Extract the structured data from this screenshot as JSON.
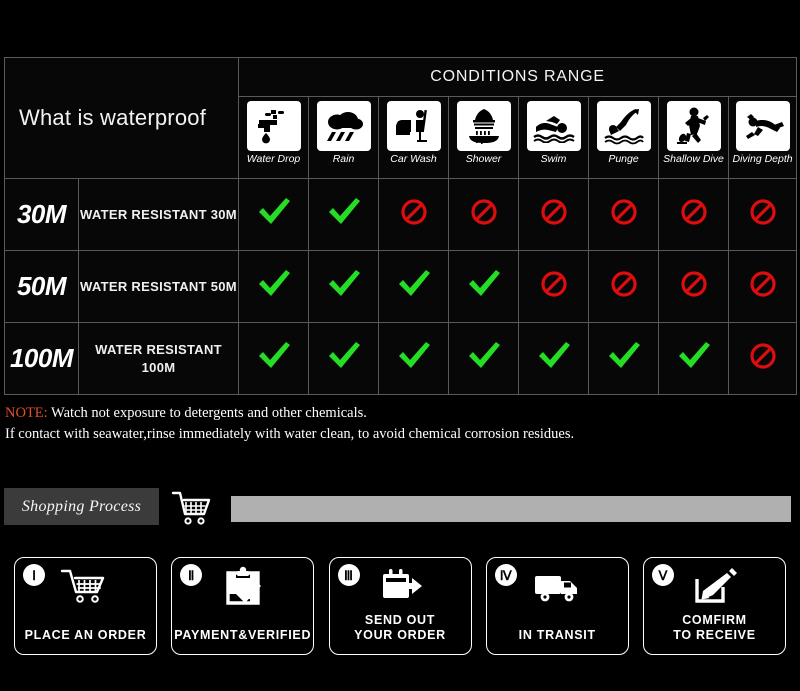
{
  "table": {
    "title": "What is waterproof",
    "conditions_header": "CONDITIONS RANGE",
    "columns": [
      {
        "label": "Water Drop",
        "icon": "faucet-water-drop-icon"
      },
      {
        "label": "Rain",
        "icon": "rain-cloud-icon"
      },
      {
        "label": "Car Wash",
        "icon": "car-wash-icon"
      },
      {
        "label": "Shower",
        "icon": "shower-icon"
      },
      {
        "label": "Swim",
        "icon": "swim-icon"
      },
      {
        "label": "Punge",
        "icon": "plunge-dive-icon"
      },
      {
        "label": "Shallow Dive",
        "icon": "shallow-dive-icon"
      },
      {
        "label": "Diving Depth",
        "icon": "scuba-diving-icon"
      }
    ],
    "rows": [
      {
        "depth": "30M",
        "description": "WATER RESISTANT  30M",
        "marks": [
          "check",
          "check",
          "no",
          "no",
          "no",
          "no",
          "no",
          "no"
        ]
      },
      {
        "depth": "50M",
        "description": "WATER RESISTANT 50M",
        "marks": [
          "check",
          "check",
          "check",
          "check",
          "no",
          "no",
          "no",
          "no"
        ]
      },
      {
        "depth": "100M",
        "description": "WATER RESISTANT  100M",
        "marks": [
          "check",
          "check",
          "check",
          "check",
          "check",
          "check",
          "check",
          "no"
        ]
      }
    ],
    "mark_colors": {
      "check": "#25dd25",
      "no": "#dd0d0d"
    }
  },
  "note": {
    "keyword": "NOTE:",
    "line1": " Watch not exposure to detergents and other chemicals.",
    "line2": "If contact with seawater,rinse immediately with water clean, to avoid chemical corrosion residues.",
    "keyword_color": "#e2502a"
  },
  "shopping": {
    "tag_label": "Shopping Process",
    "cart_icon": "shopping-cart-icon",
    "bar_color": "#b0b0b0",
    "tag_bg": "#3b3b3b"
  },
  "steps": [
    {
      "numeral": "Ⅰ",
      "icon": "shopping-cart-icon",
      "label": "PLACE AN ORDER"
    },
    {
      "numeral": "Ⅱ",
      "icon": "clipboard-check-icon",
      "label": "PAYMENT&VERIFIED"
    },
    {
      "numeral": "Ⅲ",
      "icon": "package-arrow-out-icon",
      "label": "SEND OUT\nYOUR ORDER"
    },
    {
      "numeral": "Ⅳ",
      "icon": "delivery-truck-icon",
      "label": "IN TRANSIT"
    },
    {
      "numeral": "Ⅴ",
      "icon": "pencil-signature-icon",
      "label": "COMFIRM\nTO RECEIVE"
    }
  ]
}
